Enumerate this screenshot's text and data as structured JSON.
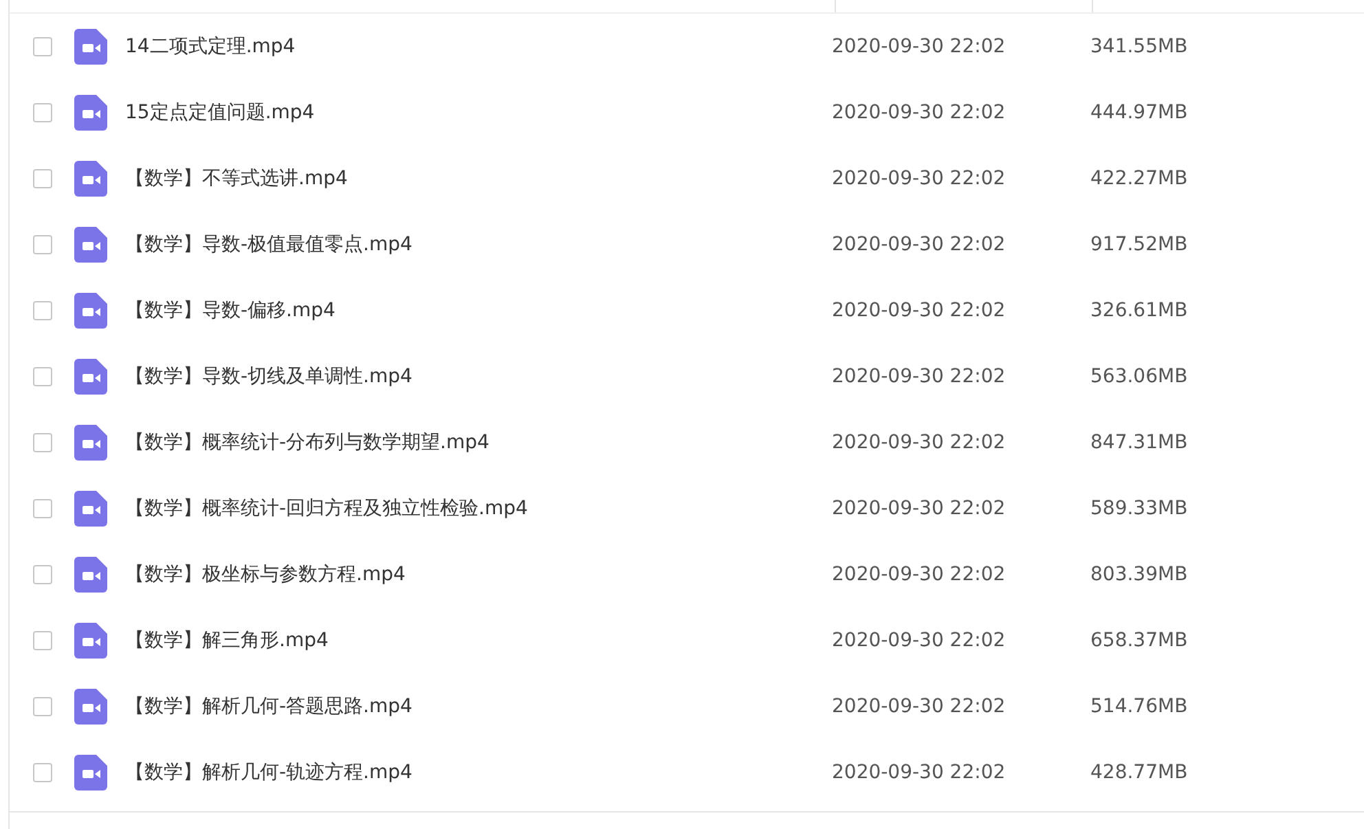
{
  "files": [
    {
      "name": "14二项式定理.mp4",
      "date": "2020-09-30 22:02",
      "size": "341.55MB",
      "checked": false
    },
    {
      "name": "15定点定值问题.mp4",
      "date": "2020-09-30 22:02",
      "size": "444.97MB",
      "checked": false
    },
    {
      "name": "【数学】不等式选讲.mp4",
      "date": "2020-09-30 22:02",
      "size": "422.27MB",
      "checked": false
    },
    {
      "name": "【数学】导数-极值最值零点.mp4",
      "date": "2020-09-30 22:02",
      "size": "917.52MB",
      "checked": false
    },
    {
      "name": "【数学】导数-偏移.mp4",
      "date": "2020-09-30 22:02",
      "size": "326.61MB",
      "checked": false
    },
    {
      "name": "【数学】导数-切线及单调性.mp4",
      "date": "2020-09-30 22:02",
      "size": "563.06MB",
      "checked": false
    },
    {
      "name": "【数学】概率统计-分布列与数学期望.mp4",
      "date": "2020-09-30 22:02",
      "size": "847.31MB",
      "checked": false
    },
    {
      "name": "【数学】概率统计-回归方程及独立性检验.mp4",
      "date": "2020-09-30 22:02",
      "size": "589.33MB",
      "checked": false
    },
    {
      "name": "【数学】极坐标与参数方程.mp4",
      "date": "2020-09-30 22:02",
      "size": "803.39MB",
      "checked": false
    },
    {
      "name": "【数学】解三角形.mp4",
      "date": "2020-09-30 22:02",
      "size": "658.37MB",
      "checked": false
    },
    {
      "name": "【数学】解析几何-答题思路.mp4",
      "date": "2020-09-30 22:02",
      "size": "514.76MB",
      "checked": false
    },
    {
      "name": "【数学】解析几何-轨迹方程.mp4",
      "date": "2020-09-30 22:02",
      "size": "428.77MB",
      "checked": false
    }
  ]
}
